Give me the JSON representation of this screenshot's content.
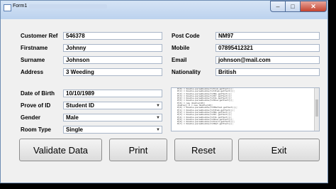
{
  "window": {
    "title": "Form1"
  },
  "form": {
    "customer_ref": {
      "label": "Customer Ref",
      "value": "546378"
    },
    "firstname": {
      "label": "Firstname",
      "value": "Johnny"
    },
    "surname": {
      "label": "Surname",
      "value": "Johnson"
    },
    "address": {
      "label": "Address",
      "value": "3 Weeding"
    },
    "post_code": {
      "label": "Post Code",
      "value": "NM97"
    },
    "mobile": {
      "label": "Mobile",
      "value": "07895412321"
    },
    "email": {
      "label": "Email",
      "value": "johnson@mail.com"
    },
    "nationality": {
      "label": "Nationality",
      "value": "British"
    },
    "date_of_birth": {
      "label": "Date of Birth",
      "value": "10/10/1989"
    },
    "prove_of_id": {
      "label": "Prove of ID",
      "value": "Student ID"
    },
    "gender": {
      "label": "Gender",
      "value": "Male"
    },
    "room_type": {
      "label": "Room Type",
      "value": "Single"
    }
  },
  "output_lines": [
    "P[0] = Double.parseDouble(txtCom.getText());",
    "P[1] = Double.parseDouble(txtItem.getText());",
    "P[2] = Double.parseDouble(txtNo.getText());",
    "P[3] = Double.parseDouble(txtPr.getText());",
    "P[4] = Double.parseDouble(txtIn.getText());",
    "P[5] = Double.parseDouble(txtDue.getText());",
    "P[6] = new double[10];",
    "double[] P = new double[10];",
    "P[0] = Double.parseDouble(txtMethod.getText());",
    "P[1] = Double.parseDouble(txtItem.getText());",
    "P[2] = Double.parseDouble(txtNo.getText());",
    "P[3] = Double.parseDouble(txtPr.getText());",
    "P[4] = Double.parseDouble(txtIn.getText());",
    "P[5] = Double.parseDouble(txtDue.getText());",
    "P[6] = Double.parseDouble(txtCard.getText());",
    "P[7] = Double.parseDouble(txtRef.getText());"
  ],
  "buttons": {
    "validate": "Validate Data",
    "print": "Print",
    "reset": "Reset",
    "exit": "Exit"
  },
  "controls": {
    "minimize": "–",
    "maximize": "□",
    "close": "✕"
  }
}
